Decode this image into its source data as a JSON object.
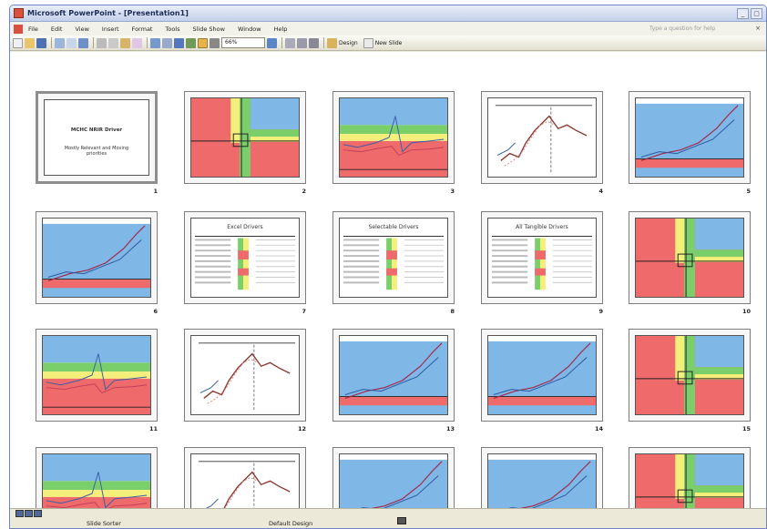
{
  "window": {
    "title": "Microsoft PowerPoint - [Presentation1]"
  },
  "menu": {
    "items": [
      "File",
      "Edit",
      "View",
      "Insert",
      "Format",
      "Tools",
      "Slide Show",
      "Window",
      "Help"
    ],
    "ask_placeholder": "Type a question for help"
  },
  "toolbar": {
    "zoom": "66%",
    "design_label": "Design",
    "new_slide_label": "New Slide"
  },
  "slides": [
    {
      "num": "1",
      "type": "title",
      "title": "MCHC NRIR Driver",
      "subtitle": "Mostly Relevant and Moving priorities"
    },
    {
      "num": "2",
      "type": "quad"
    },
    {
      "num": "3",
      "type": "bands"
    },
    {
      "num": "4",
      "type": "line"
    },
    {
      "num": "5",
      "type": "blue"
    },
    {
      "num": "6",
      "type": "blue"
    },
    {
      "num": "7",
      "type": "table",
      "title": "Excel Drivers"
    },
    {
      "num": "8",
      "type": "table",
      "title": "Selectable Drivers"
    },
    {
      "num": "9",
      "type": "table",
      "title": "All Tangible Drivers"
    },
    {
      "num": "10",
      "type": "quad"
    },
    {
      "num": "11",
      "type": "bands"
    },
    {
      "num": "12",
      "type": "line"
    },
    {
      "num": "13",
      "type": "blue"
    },
    {
      "num": "14",
      "type": "blue"
    },
    {
      "num": "15",
      "type": "quad"
    },
    {
      "num": "",
      "type": "bands"
    },
    {
      "num": "",
      "type": "line"
    },
    {
      "num": "",
      "type": "blue"
    },
    {
      "num": "",
      "type": "blue"
    },
    {
      "num": "",
      "type": "quad"
    }
  ],
  "status": {
    "view": "Slide Sorter",
    "design": "Default Design"
  },
  "colors": {
    "red": "#ef6a6a",
    "green": "#7bcf6b",
    "yellow": "#f3ef7a",
    "blue": "#7fb7e6"
  }
}
